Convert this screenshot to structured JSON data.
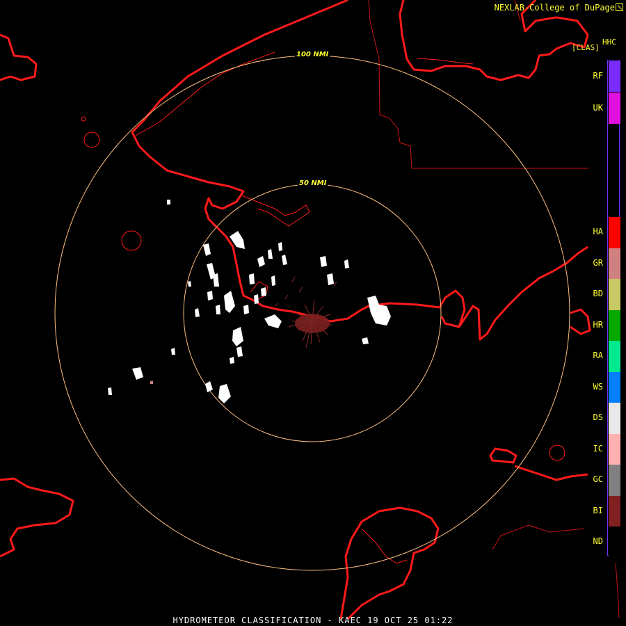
{
  "credit": "NEXLAB-College of DuPage",
  "product_code": "HHC",
  "class_label": "[CLAS]",
  "footer": "HYDROMETEOR CLASSIFICATION - KAEC 19 OCT 25 01:22",
  "ring_labels": [
    "50 NMI",
    "100 NMI"
  ],
  "map_colors": {
    "background": "#000000",
    "coastline": "#ff1a1a",
    "border": "#cc1414",
    "range_ring": "#ffc080",
    "ring_label": "#ffff33",
    "echo_dry_snow": "#ffffff",
    "echo_biological": "#8b2a2a"
  },
  "legend": [
    {
      "code": "RF",
      "color": "#7a2cff"
    },
    {
      "code": "UK",
      "color": "#e010e0"
    },
    {
      "code": "HA",
      "color": "#ff0000"
    },
    {
      "code": "GR",
      "color": "#d08080"
    },
    {
      "code": "BD",
      "color": "#c8c864"
    },
    {
      "code": "HR",
      "color": "#00a800"
    },
    {
      "code": "RA",
      "color": "#00e890"
    },
    {
      "code": "WS",
      "color": "#0080ff"
    },
    {
      "code": "DS",
      "color": "#e8e8e8"
    },
    {
      "code": "IC",
      "color": "#ffb0b0"
    },
    {
      "code": "GC",
      "color": "#808080"
    },
    {
      "code": "BI",
      "color": "#802020"
    },
    {
      "code": "ND",
      "color": "#000000"
    }
  ]
}
